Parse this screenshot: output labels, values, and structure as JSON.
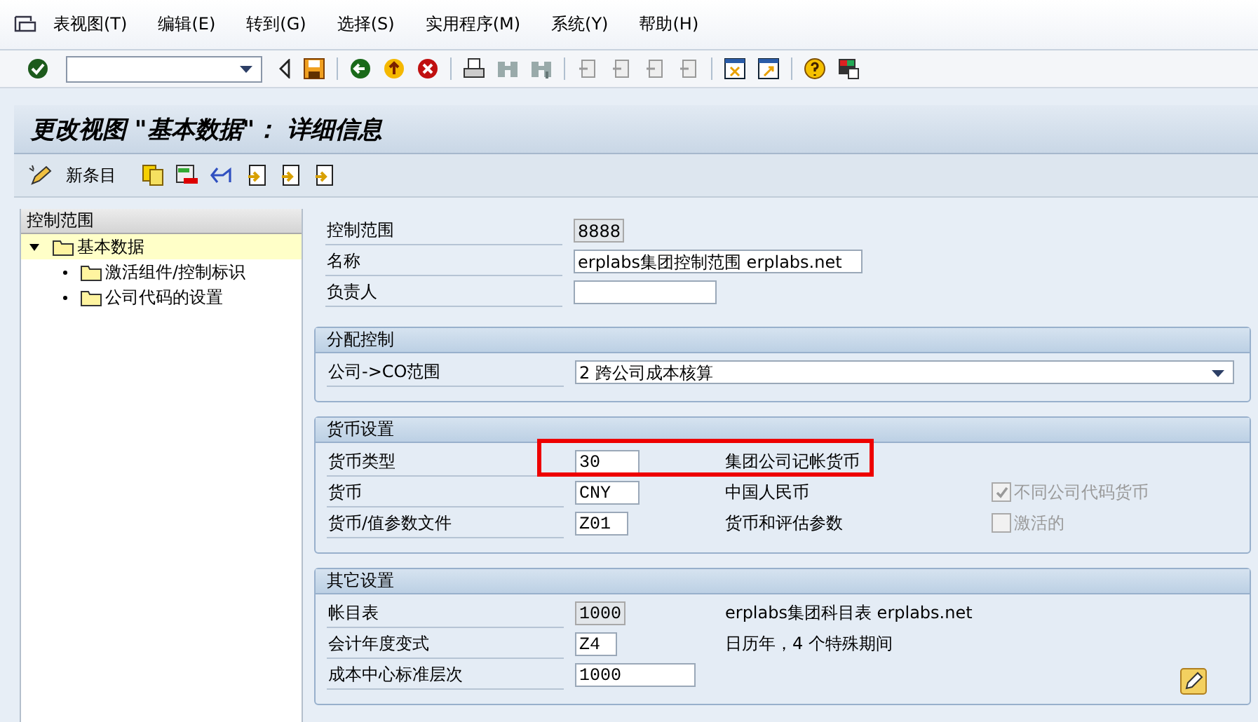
{
  "menu": [
    {
      "label": "表视图(T)"
    },
    {
      "label": "编辑(E)"
    },
    {
      "label": "转到(G)"
    },
    {
      "label": "选择(S)"
    },
    {
      "label": "实用程序(M)"
    },
    {
      "label": "系统(Y)"
    },
    {
      "label": "帮助(H)"
    }
  ],
  "title": "更改视图 \"基本数据\"： 详细信息",
  "app_toolbar": {
    "new_entries": "新条目"
  },
  "tree": {
    "header": "控制范围",
    "items": [
      {
        "label": "基本数据",
        "expanded": true,
        "selected": true,
        "children": [
          {
            "label": "激活组件/控制标识",
            "selected": false
          },
          {
            "label": "公司代码的设置",
            "selected": false
          }
        ]
      }
    ]
  },
  "header_fields": [
    {
      "label": "控制范围",
      "value": "8888",
      "readonly": true
    },
    {
      "label": "名称",
      "value": "erplabs集团控制范围 erplabs.net",
      "readonly": false
    },
    {
      "label": "负责人",
      "readonly": false
    }
  ],
  "sections": [
    {
      "title": "分配控制",
      "rows": [
        {
          "label": "公司->CO范围",
          "kind": "dropdown",
          "value": "2 跨公司成本核算",
          "readonly": false
        }
      ]
    },
    {
      "title": "货币设置",
      "rows": [
        {
          "label": "货币类型",
          "kind": "input",
          "value": "30",
          "readonly": false,
          "description": "集团公司记帐货币"
        },
        {
          "label": "货币",
          "kind": "input",
          "value": "CNY",
          "readonly": false,
          "description": "中国人民币",
          "checkbox": {
            "label": "不同公司代码货币",
            "checked": true,
            "disabled": true
          }
        },
        {
          "label": "货币/值参数文件",
          "kind": "input",
          "value": "Z01",
          "readonly": false,
          "description": "货币和评估参数",
          "checkbox": {
            "label": "激活的",
            "checked": false,
            "disabled": true
          }
        }
      ]
    },
    {
      "title": "其它设置",
      "rows": [
        {
          "label": "帐目表",
          "kind": "input",
          "value": "1000",
          "readonly": true,
          "description": "erplabs集团科目表 erplabs.net"
        },
        {
          "label": "会计年度变式",
          "kind": "input",
          "value": "Z4",
          "readonly": false,
          "description": "日历年，4 个特殊期间"
        },
        {
          "label": "成本中心标准层次",
          "kind": "input",
          "value": "1000",
          "readonly": false
        }
      ]
    }
  ]
}
